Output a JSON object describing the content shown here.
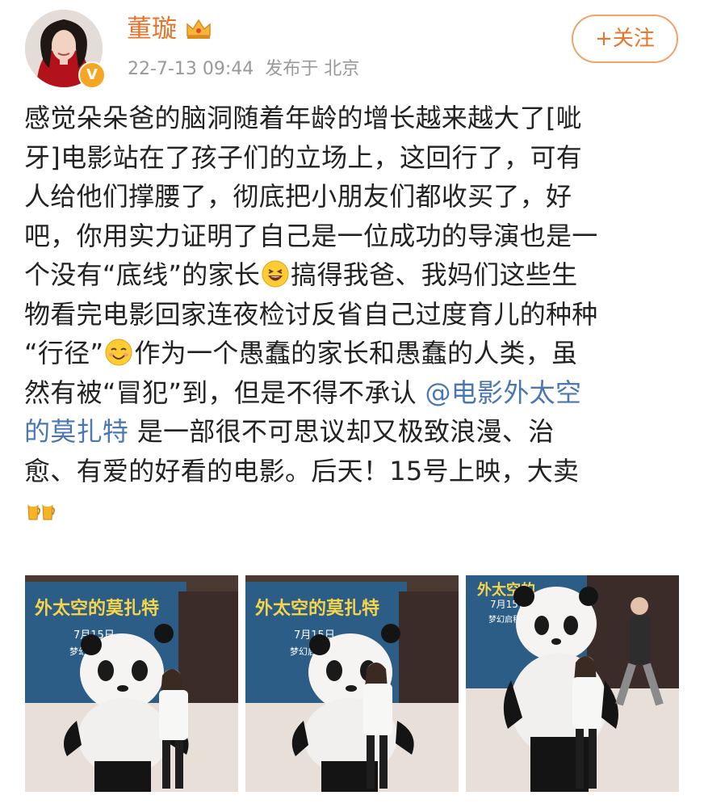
{
  "author": {
    "name": "董璇",
    "verified_badge": "V"
  },
  "meta": {
    "time": "22-7-13 09:44",
    "location": "发布于 北京"
  },
  "follow_button": "+关注",
  "post": {
    "lines": [
      [
        "感觉朵朵爸的脑洞随着年龄的增长越来越大了[呲"
      ],
      [
        "牙]电影站在了孩子们的立场上，这回行了，可有"
      ],
      [
        "人给他们撑腰了，彻底把小朋友们都收买了，好"
      ],
      [
        "吧，你用实力证明了自己是一位成功的导演也是一"
      ],
      [
        "个没有“底线”的家长",
        "搞得我爸、我妈们这些生"
      ],
      [
        "物看完电影回家连夜检讨反省自己过度育儿的种种"
      ],
      [
        "“行径”",
        "作为一个愚蠢的家长和愚蠢的人类，虽"
      ],
      [
        "然有被“冒犯”到，但是不得不承认 "
      ],
      [
        "是一部很不可思议却又极致浪漫、治"
      ],
      [
        "愈、有爱的好看的电影。后天！15号上映，大卖"
      ]
    ],
    "mention_part1": "@电影外太空",
    "mention_part2": "的莫扎特",
    "emojis": [
      "laughing-emoji",
      "smile-emoji",
      "cheers-emoji"
    ]
  },
  "photos": [
    {
      "poster_text": "外太空的莫扎特",
      "date_text": "7月15日",
      "tagline": "梦幻启程 欢乐一夏"
    },
    {
      "poster_text": "外太空的莫扎特",
      "date_text": "7月15日",
      "tagline": "梦幻启程 欢乐一"
    },
    {
      "poster_text": "外太空的",
      "date_text": "7月15日",
      "tagline": "梦幻启程 欢"
    }
  ],
  "colors": {
    "name": "#e8732a",
    "meta": "#999999",
    "mention": "#4a77b4",
    "text": "#222222",
    "follow_border": "#f0a36c"
  }
}
